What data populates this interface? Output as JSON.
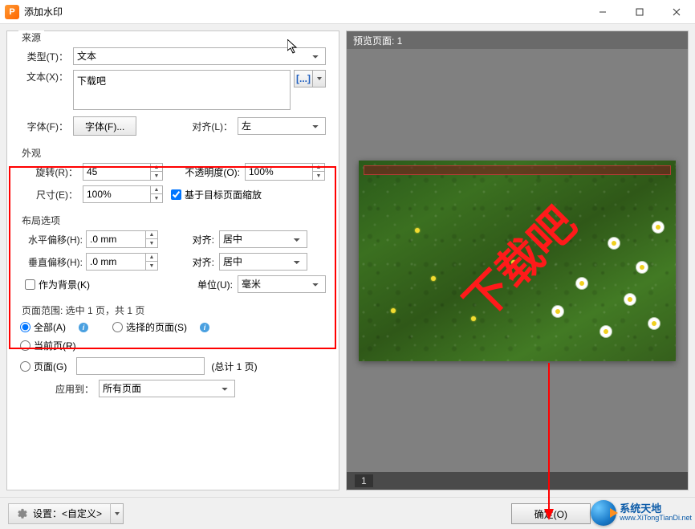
{
  "window": {
    "title": "添加水印"
  },
  "source": {
    "title": "来源",
    "type_label": "类型(T)：",
    "type_value": "文本",
    "text_label": "文本(X)：",
    "text_value": "下载吧",
    "browse_icon": "[...]",
    "font_label": "字体(F)：",
    "font_button": "字体(F)...",
    "align_label": "对齐(L)：",
    "align_value": "左"
  },
  "appearance": {
    "title": "外观",
    "rotate_label": "旋转(R)：",
    "rotate_value": "45",
    "opacity_label": "不透明度(O):",
    "opacity_value": "100%",
    "scale_label": "尺寸(E)：",
    "scale_value": "100%",
    "scale_checkbox": "基于目标页面缩放"
  },
  "layout": {
    "title": "布局选项",
    "hoffset_label": "水平偏移(H):",
    "hoffset_value": ".0 mm",
    "voffset_label": "垂直偏移(H):",
    "voffset_value": ".0 mm",
    "align1_label": "对齐:",
    "align1_value": "居中",
    "align2_label": "对齐:",
    "align2_value": "居中",
    "unit_label": "单位(U):",
    "unit_value": "毫米",
    "as_bg_label": "作为背景(K)"
  },
  "pagerange": {
    "title": "页面范围: 选中 1 页，共 1 页",
    "opt_all": "全部(A)",
    "opt_current": "当前页(R)",
    "opt_selected": "选择的页面(S)",
    "opt_pages": "页面(G)",
    "pages_value": "",
    "pages_hint": "(总计 1 页)",
    "applyto_label": "应用到：",
    "applyto_value": "所有页面"
  },
  "preview": {
    "header": "预览页面:  1",
    "watermark_text": "下载吧",
    "page_indicator": "1"
  },
  "footer": {
    "settings_label": "设置：<自定义>",
    "ok_label": "确定(O)"
  },
  "branding": {
    "cn": "系统天地",
    "en": "www.XiTongTianDi.net"
  }
}
